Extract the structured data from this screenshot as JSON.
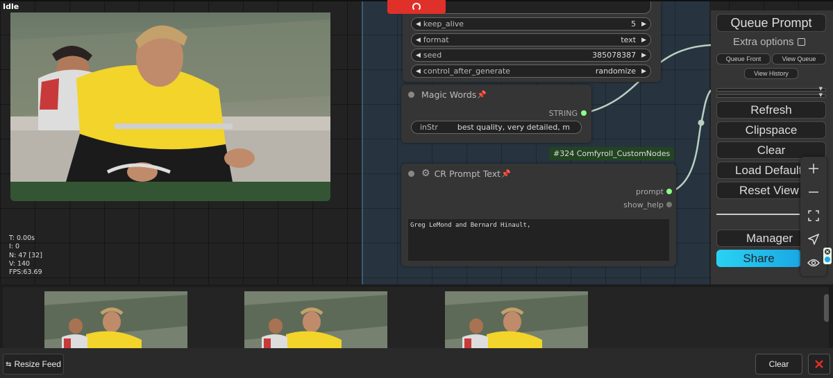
{
  "status": {
    "idle": "Idle"
  },
  "stats": {
    "t": "T: 0.00s",
    "i": "I: 0",
    "n": "N: 47 [32]",
    "v": "V: 140",
    "fps": "FPS:63.69"
  },
  "sampler_widgets": [
    {
      "label": "keep_alive",
      "value": "5"
    },
    {
      "label": "format",
      "value": "text"
    },
    {
      "label": "seed",
      "value": "385078387"
    },
    {
      "label": "control_after_generate",
      "value": "randomize"
    }
  ],
  "magic_node": {
    "title": "Magic Words",
    "output": "STRING",
    "input_label": "inStr",
    "input_value": "best quality, very detailed, m"
  },
  "tooltip": "#324 Comfyroll_CustomNodes",
  "prompt_node": {
    "title": "CR Prompt Text",
    "output_prompt": "prompt",
    "output_help": "show_help",
    "text": "Greg LeMond and Bernard Hinault,"
  },
  "menu": {
    "queue_prompt": "Queue Prompt",
    "extra_options": "Extra options",
    "queue_front": "Queue Front",
    "view_queue": "View Queue",
    "view_history": "View History",
    "refresh": "Refresh",
    "clipspace": "Clipspace",
    "clear": "Clear",
    "load_default": "Load Default",
    "reset_view": "Reset View",
    "manager": "Manager",
    "share": "Share"
  },
  "feed": {
    "resize_label": "Resize Feed",
    "clear_label": "Clear"
  },
  "colors": {
    "accent_red": "#e0302a",
    "group_bg": "#27343f",
    "preview_node": "#335533",
    "share_gradient": "#2ad2f2",
    "link_color": "#b8d4b8",
    "slot_green": "#8f8"
  }
}
